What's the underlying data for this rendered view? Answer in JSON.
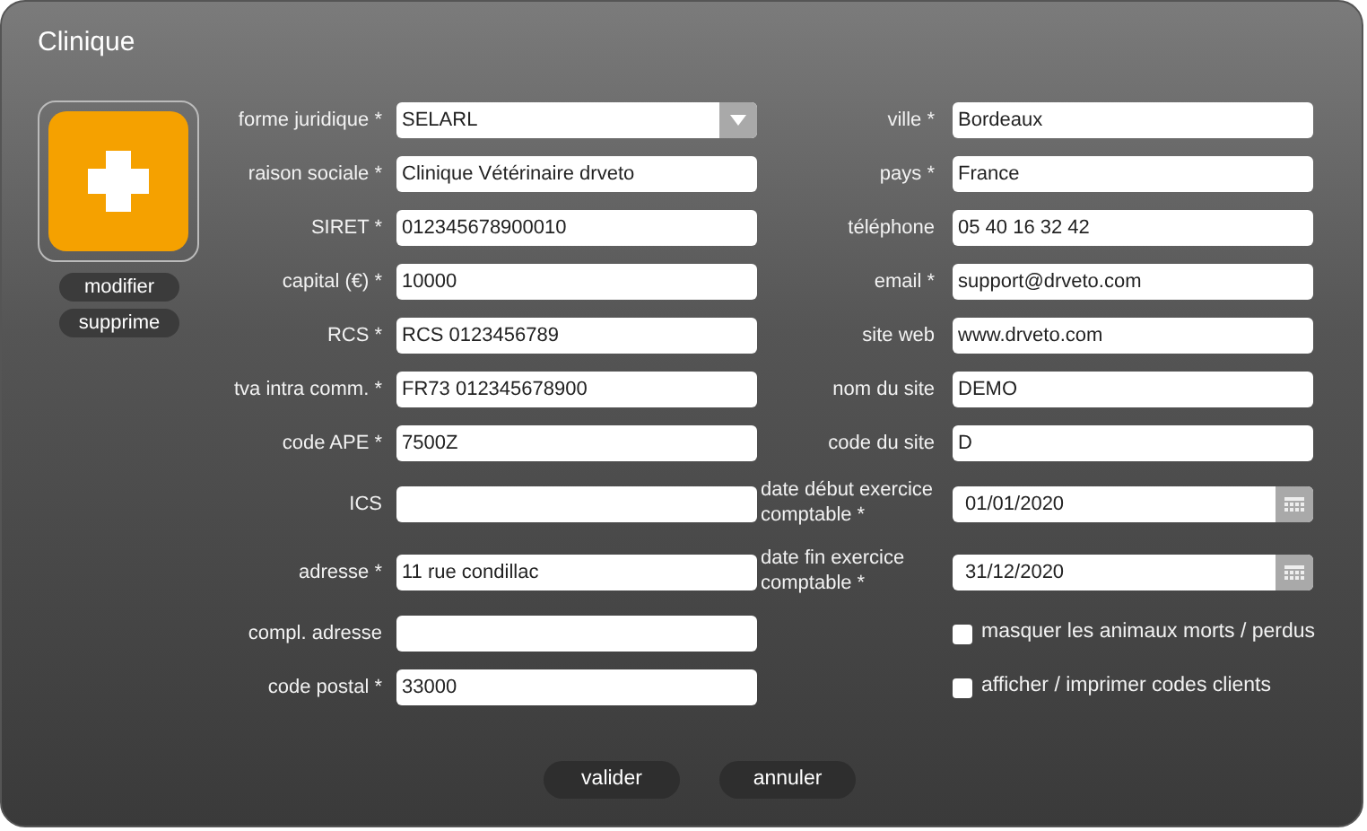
{
  "window": {
    "title": "Clinique"
  },
  "logo": {
    "buttons": [
      "modifier",
      "supprime"
    ]
  },
  "left_fields": [
    {
      "kind": "select",
      "label": "forme juridique *",
      "value": "SELARL"
    },
    {
      "kind": "text",
      "label": "raison sociale *",
      "value": "Clinique Vétérinaire drveto"
    },
    {
      "kind": "text",
      "label": "SIRET *",
      "value": "012345678900010"
    },
    {
      "kind": "text",
      "label": "capital (€) *",
      "value": "10000"
    },
    {
      "kind": "text",
      "label": "RCS *",
      "value": "RCS 0123456789"
    },
    {
      "kind": "text",
      "label": "tva intra comm. *",
      "value": "FR73 012345678900"
    },
    {
      "kind": "text",
      "label": "code APE *",
      "value": "7500Z"
    },
    {
      "kind": "text",
      "label": "ICS"
    },
    {
      "kind": "text",
      "label": "adresse *",
      "value": "11 rue condillac"
    },
    {
      "kind": "text",
      "label": "compl. adresse"
    },
    {
      "kind": "text",
      "label": "code postal *",
      "value": "33000"
    }
  ],
  "right_fields": [
    {
      "kind": "text",
      "label": "ville *",
      "value": "Bordeaux"
    },
    {
      "kind": "text",
      "label": "pays *",
      "value": "France"
    },
    {
      "kind": "text",
      "label": "téléphone",
      "value": "05 40 16 32 42"
    },
    {
      "kind": "text",
      "label": "email *",
      "value": "support@drveto.com"
    },
    {
      "kind": "text",
      "label": "site web",
      "value": "www.drveto.com"
    },
    {
      "kind": "text",
      "label": "nom du site",
      "value": "DEMO"
    },
    {
      "kind": "text",
      "label": "code du site",
      "value": "D"
    },
    {
      "kind": "date",
      "label": "date début exercice comptable *",
      "value": "01/01/2020"
    },
    {
      "kind": "date",
      "label": "date fin exercice comptable *",
      "value": "31/12/2020"
    },
    {
      "kind": "checkbox",
      "label": "masquer les animaux morts / perdus",
      "checked": false
    },
    {
      "kind": "checkbox",
      "label": "afficher / imprimer codes clients",
      "checked": false
    }
  ],
  "buttons": [
    "valider",
    "annuler"
  ]
}
